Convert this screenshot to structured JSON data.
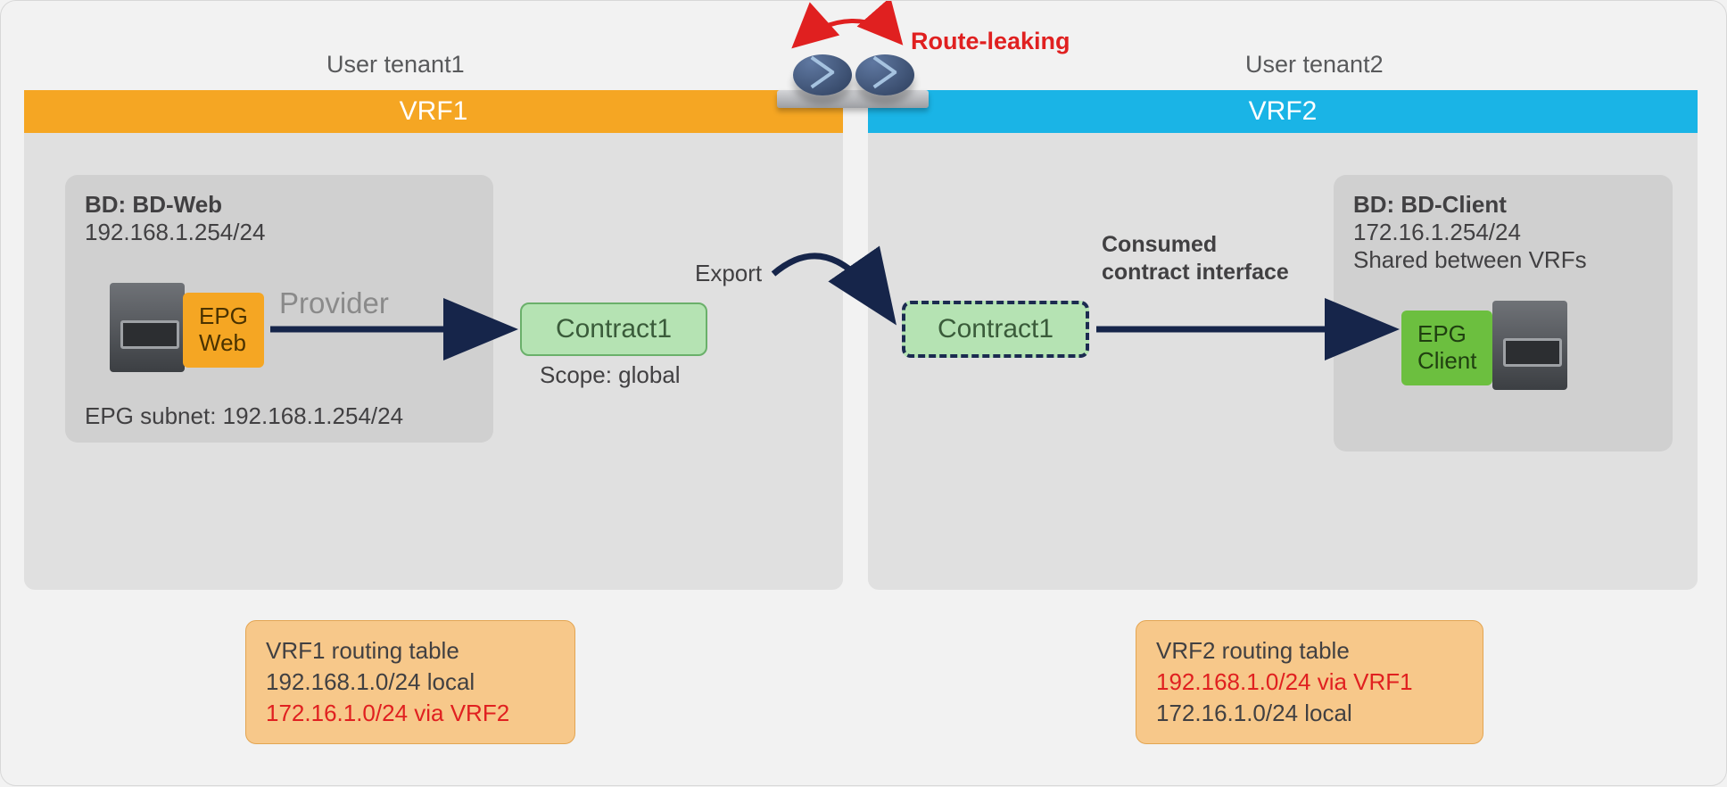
{
  "route_leak_label": "Route-leaking",
  "tenant1": {
    "label": "User tenant1",
    "vrf_title": "VRF1",
    "bd": {
      "title": "BD: BD-Web",
      "subnet": "192.168.1.254/24"
    },
    "epg": {
      "label1": "EPG",
      "label2": "Web"
    },
    "epg_subnet": "EPG subnet: 192.168.1.254/24",
    "provider_label": "Provider"
  },
  "contract": {
    "name": "Contract1",
    "export_label": "Export",
    "exported_name": "Contract1",
    "scope_label": "Scope: global"
  },
  "tenant2": {
    "label": "User tenant2",
    "vrf_title": "VRF2",
    "consumed_line1": "Consumed",
    "consumed_line2": "contract interface",
    "bd": {
      "title": "BD: BD-Client",
      "subnet": "172.16.1.254/24",
      "shared": "Shared between VRFs"
    },
    "epg": {
      "label1": "EPG",
      "label2": "Client"
    }
  },
  "routing_tables": {
    "vrf1": {
      "title": "VRF1 routing table",
      "local": "192.168.1.0/24 local",
      "leaked": "172.16.1.0/24 via VRF2"
    },
    "vrf2": {
      "title": "VRF2 routing table",
      "leaked": "192.168.1.0/24 via VRF1",
      "local": "172.16.1.0/24 local"
    }
  }
}
